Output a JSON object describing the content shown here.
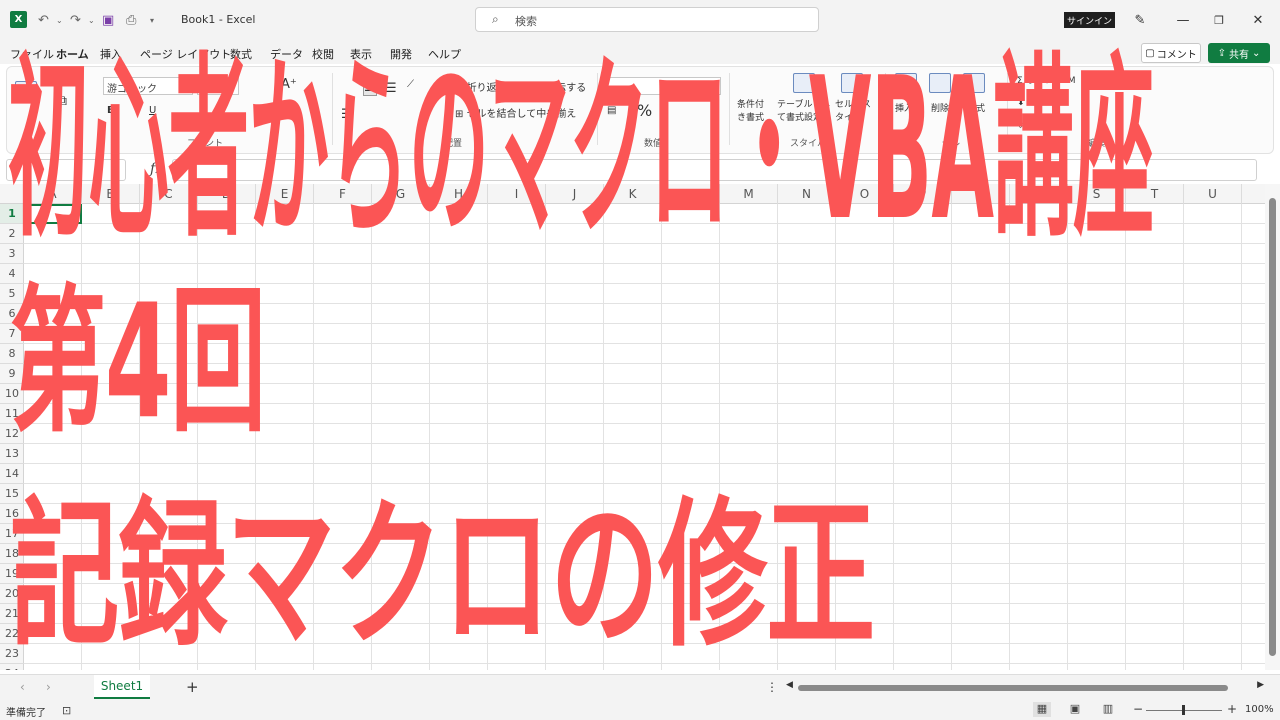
{
  "titlebar": {
    "app_logo": "X",
    "doc_title": "Book1  -  Excel",
    "search_placeholder": "検索",
    "signin_label": "サインイン"
  },
  "menu": {
    "tabs": [
      "ファイル",
      "ホーム",
      "挿入",
      "ページ レイアウト",
      "数式",
      "データ",
      "校閲",
      "表示",
      "開発",
      "ヘルプ"
    ],
    "comment_label": "コメント",
    "share_label": "共有"
  },
  "ribbon": {
    "font_name": "游ゴシック",
    "format_value": "",
    "wrap_text": "折り返して全体を表示する",
    "merge_center": "セルを結合して中央揃え",
    "percent": "%",
    "conditional_format": "条件付き書式",
    "format_as_table": "テーブルとして書式設定",
    "cell_styles": "セルのスタイル",
    "insert": "挿入",
    "delete": "削除",
    "format": "書式",
    "autosum": "オート SUM",
    "fill": "フィル",
    "clear": "クリア",
    "groups": {
      "font": "フォント",
      "alignment": "配置",
      "number": "数値",
      "styles": "スタイル",
      "cells": "セル",
      "editing": "編集"
    }
  },
  "formula_bar": {
    "fx": "fx",
    "name_box": "",
    "formula": ""
  },
  "grid": {
    "columns": [
      "A",
      "B",
      "C",
      "D",
      "E",
      "F",
      "G",
      "H",
      "I",
      "J",
      "K",
      "L",
      "M",
      "N",
      "O",
      "P",
      "Q",
      "R",
      "S",
      "T",
      "U"
    ],
    "rows": [
      "1",
      "2",
      "3",
      "4",
      "5",
      "6",
      "7",
      "8",
      "9",
      "10",
      "11",
      "12",
      "13",
      "14",
      "15",
      "16",
      "17",
      "18",
      "19",
      "20",
      "21",
      "22",
      "23",
      "24"
    ],
    "active_cell": "A1"
  },
  "sheets": {
    "tabs": [
      "Sheet1"
    ],
    "active": "Sheet1"
  },
  "status": {
    "text": "準備完了",
    "zoom": "100%",
    "zoom_fraction": 0.5
  },
  "overlay": {
    "line1": "初心者からのマクロ・VBA講座",
    "line2": "第4回",
    "line3": "記録マクロの修正"
  },
  "colors": {
    "excel_green": "#107c41",
    "overlay_red": "#fb5555"
  }
}
